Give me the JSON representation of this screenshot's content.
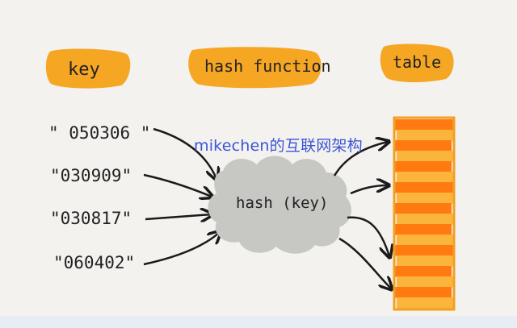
{
  "headers": {
    "key": "key",
    "hash_function": "hash function",
    "table": "table"
  },
  "keys": [
    "\" 050306 \"",
    "\"030909\"",
    "\"030817\"",
    "\"060402\""
  ],
  "hash_blob_label": "hash (key)",
  "watermark": "mikechen的互联网架构",
  "colors": {
    "background": "#f3f2ef",
    "pill": "#f5a623",
    "blob": "#c7c7c4",
    "table_light": "#fbb43c",
    "table_dark": "#ff7a10",
    "watermark": "#3a55d6"
  },
  "table_rows": [
    "dark",
    "light",
    "dark",
    "light",
    "dark",
    "light",
    "dark",
    "light",
    "dark",
    "light",
    "dark",
    "light",
    "dark",
    "light",
    "dark",
    "light",
    "dark",
    "light"
  ]
}
